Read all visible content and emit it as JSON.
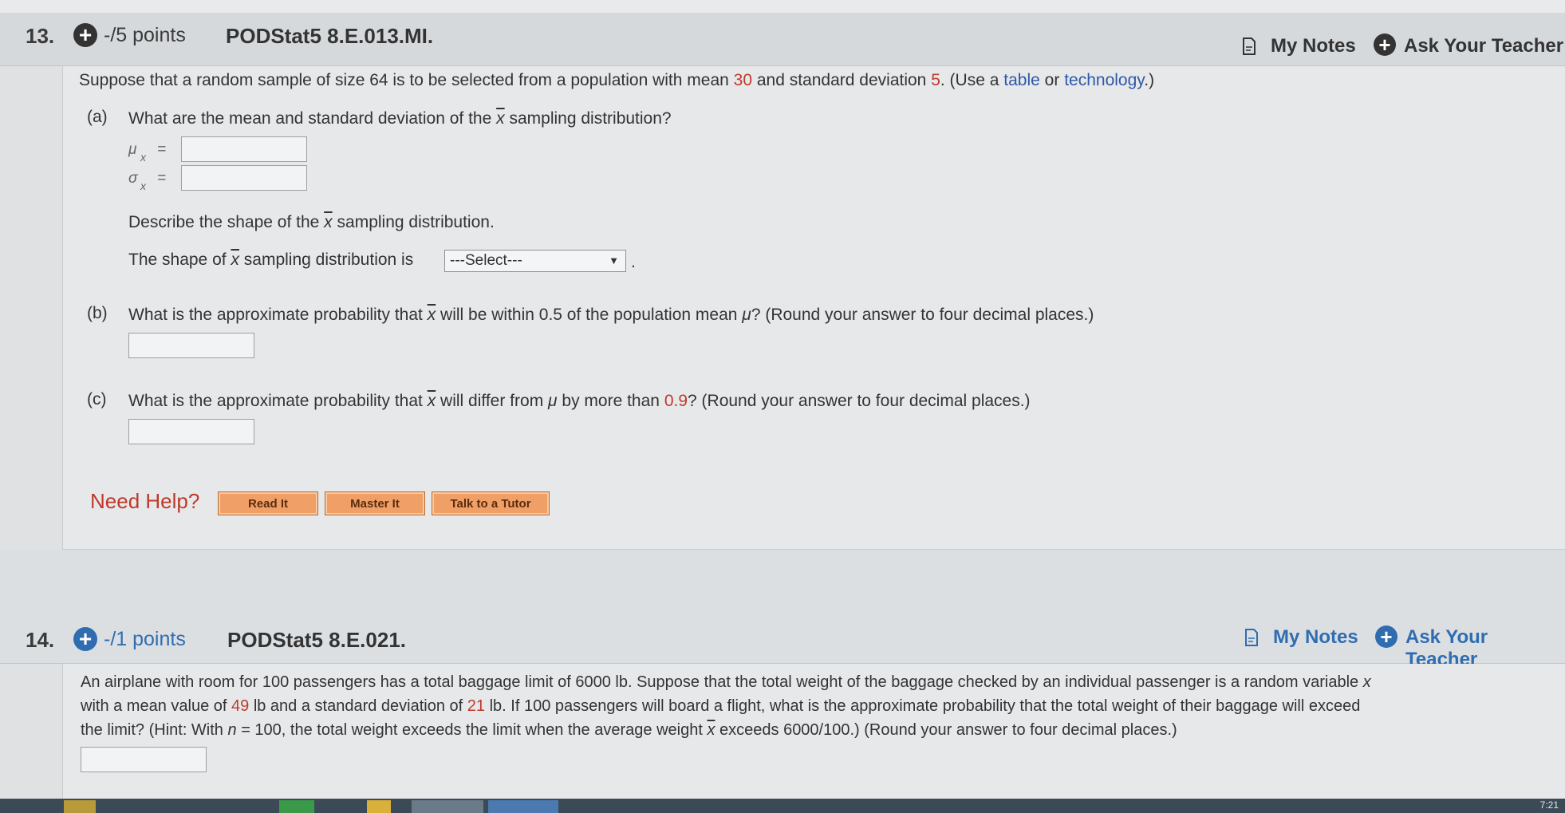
{
  "q13": {
    "number": "13.",
    "points": "-/5 points",
    "code": "PODStat5 8.E.013.MI.",
    "my_notes": "My Notes",
    "ask_teacher": "Ask Your Teacher",
    "intro_a": "Suppose that a random sample of size 64 is to be selected from a population with mean",
    "mean": "30",
    "intro_b": "and standard deviation",
    "sd": "5",
    "intro_c": ". (Use",
    "a_word": "a",
    "table_link": "table",
    "or_word": "or",
    "tech_link": "technology",
    "intro_d": ".)",
    "a_label": "(a)",
    "a_q1": "What are the mean and standard deviation of the",
    "xbar": "x",
    "a_q2": "sampling distribution?",
    "mu_sym": "μ",
    "sigma_sym": "σ",
    "equals": "=",
    "shape_q1": "Describe the shape of the",
    "shape_q2": "sampling distribution.",
    "shape_s1": "The shape of",
    "shape_s2": "sampling distribution is",
    "select_value": "---Select---",
    "period": ".",
    "b_label": "(b)",
    "b_q1": "What is the approximate probability that",
    "b_q2": "will be within 0.5 of the population mean",
    "mu": "μ",
    "b_q3": "? (Round your answer to four decimal places.)",
    "c_label": "(c)",
    "c_q1": "What is the approximate probability that",
    "c_q2": "will differ from",
    "c_q3": "by more than",
    "c_val": "0.9",
    "c_q4": "? (Round your answer to four decimal places.)",
    "need_help": "Need Help?",
    "btn_read": "Read It",
    "btn_master": "Master It",
    "btn_tutor": "Talk to a Tutor"
  },
  "q14": {
    "number": "14.",
    "points": "-/1 points",
    "code": "PODStat5 8.E.021.",
    "my_notes": "My Notes",
    "ask_teacher": "Ask Your Teacher",
    "l1": "An airplane with room for 100 passengers has a total baggage limit of 6000 lb. Suppose that the total weight of the baggage checked by an individual passenger is a random variable",
    "x_it": "x",
    "l2a": "with a mean value of",
    "mean": "49",
    "l2b": "lb and a standard deviation of",
    "sd": "21",
    "l2c": "lb. If 100 passengers will board a flight, what is the approximate probability that the total weight of their baggage will exceed",
    "l3a": "the limit? (Hint: With",
    "n_it": "n",
    "l3b": "= 100, the total weight exceeds the limit when the average weight",
    "l3c": "exceeds 6000/100.) (Round your answer to four decimal places.)"
  },
  "taskbar": {
    "clock": "7:21"
  },
  "colors": {
    "accent_blue": "#2f6db0",
    "value_red": "#c0392b",
    "help_orange": "#f0a067"
  }
}
